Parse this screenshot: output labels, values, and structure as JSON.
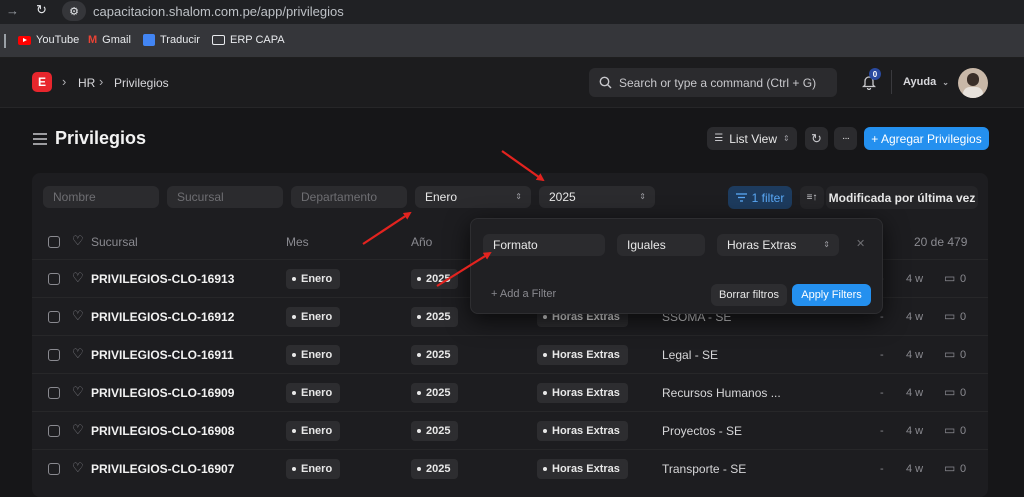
{
  "browser": {
    "url": "capacitacion.shalom.com.pe/app/privilegios",
    "bookmarks": [
      "YouTube",
      "Gmail",
      "Traducir",
      "ERP CAPA"
    ]
  },
  "navbar": {
    "logo_letter": "E",
    "breadcrumbs": [
      "HR",
      "Privilegios"
    ],
    "search_placeholder": "Search or type a command (Ctrl + G)",
    "notification_count": "0",
    "help_label": "Ayuda"
  },
  "page": {
    "title": "Privilegios",
    "list_view_label": "List View",
    "more_label": "···",
    "add_button": "+ Agregar Privilegios"
  },
  "filters": {
    "name_placeholder": "Nombre",
    "sucursal_placeholder": "Sucursal",
    "departamento_placeholder": "Departamento",
    "mes_value": "Enero",
    "anio_value": "2025",
    "filter_button": "1 filter",
    "sort_label": "Modificada por última vez"
  },
  "filter_popover": {
    "field": "Formato",
    "operator": "Iguales",
    "value": "Horas Extras",
    "add_filter": "+ Add a Filter",
    "clear_button": "Borrar filtros",
    "apply_button": "Apply Filters"
  },
  "table": {
    "headers": {
      "sucursal": "Sucursal",
      "mes": "Mes",
      "anio": "Año",
      "count": "20 de 479"
    },
    "rows": [
      {
        "name": "PRIVILEGIOS-CLO-16913",
        "mes": "Enero",
        "anio": "2025",
        "formato": "",
        "area": "",
        "dash": "-",
        "time": "4 w",
        "comments": "0"
      },
      {
        "name": "PRIVILEGIOS-CLO-16912",
        "mes": "Enero",
        "anio": "2025",
        "formato": "Horas Extras",
        "area": "SSOMA - SE",
        "dash": "-",
        "time": "4 w",
        "comments": "0"
      },
      {
        "name": "PRIVILEGIOS-CLO-16911",
        "mes": "Enero",
        "anio": "2025",
        "formato": "Horas Extras",
        "area": "Legal - SE",
        "dash": "-",
        "time": "4 w",
        "comments": "0"
      },
      {
        "name": "PRIVILEGIOS-CLO-16909",
        "mes": "Enero",
        "anio": "2025",
        "formato": "Horas Extras",
        "area": "Recursos Humanos ...",
        "dash": "-",
        "time": "4 w",
        "comments": "0"
      },
      {
        "name": "PRIVILEGIOS-CLO-16908",
        "mes": "Enero",
        "anio": "2025",
        "formato": "Horas Extras",
        "area": "Proyectos - SE",
        "dash": "-",
        "time": "4 w",
        "comments": "0"
      },
      {
        "name": "PRIVILEGIOS-CLO-16907",
        "mes": "Enero",
        "anio": "2025",
        "formato": "Horas Extras",
        "area": "Transporte - SE",
        "dash": "-",
        "time": "4 w",
        "comments": "0"
      }
    ]
  },
  "colors": {
    "accent": "#2490ef",
    "logo": "#e8262d",
    "annotation_arrow": "#e3231f"
  }
}
